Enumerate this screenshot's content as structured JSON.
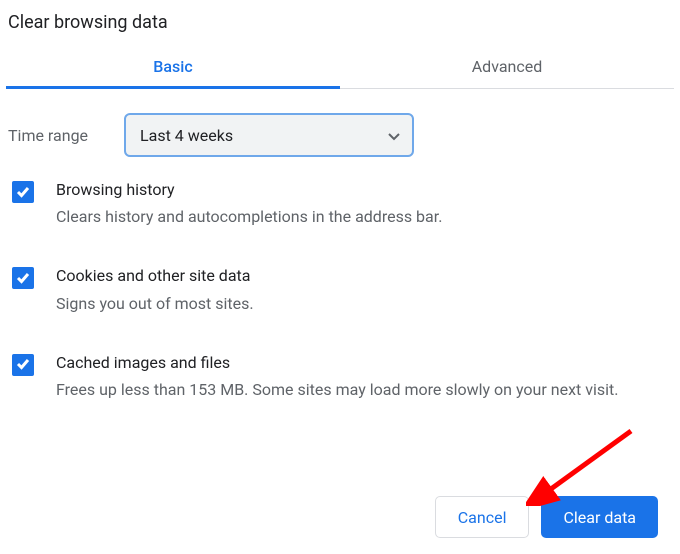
{
  "title": "Clear browsing data",
  "tabs": {
    "basic": "Basic",
    "advanced": "Advanced"
  },
  "time": {
    "label": "Time range",
    "value": "Last 4 weeks"
  },
  "options": [
    {
      "title": "Browsing history",
      "desc": "Clears history and autocompletions in the address bar."
    },
    {
      "title": "Cookies and other site data",
      "desc": "Signs you out of most sites."
    },
    {
      "title": "Cached images and files",
      "desc": "Frees up less than 153 MB. Some sites may load more slowly on your next visit."
    }
  ],
  "buttons": {
    "cancel": "Cancel",
    "clear": "Clear data"
  }
}
